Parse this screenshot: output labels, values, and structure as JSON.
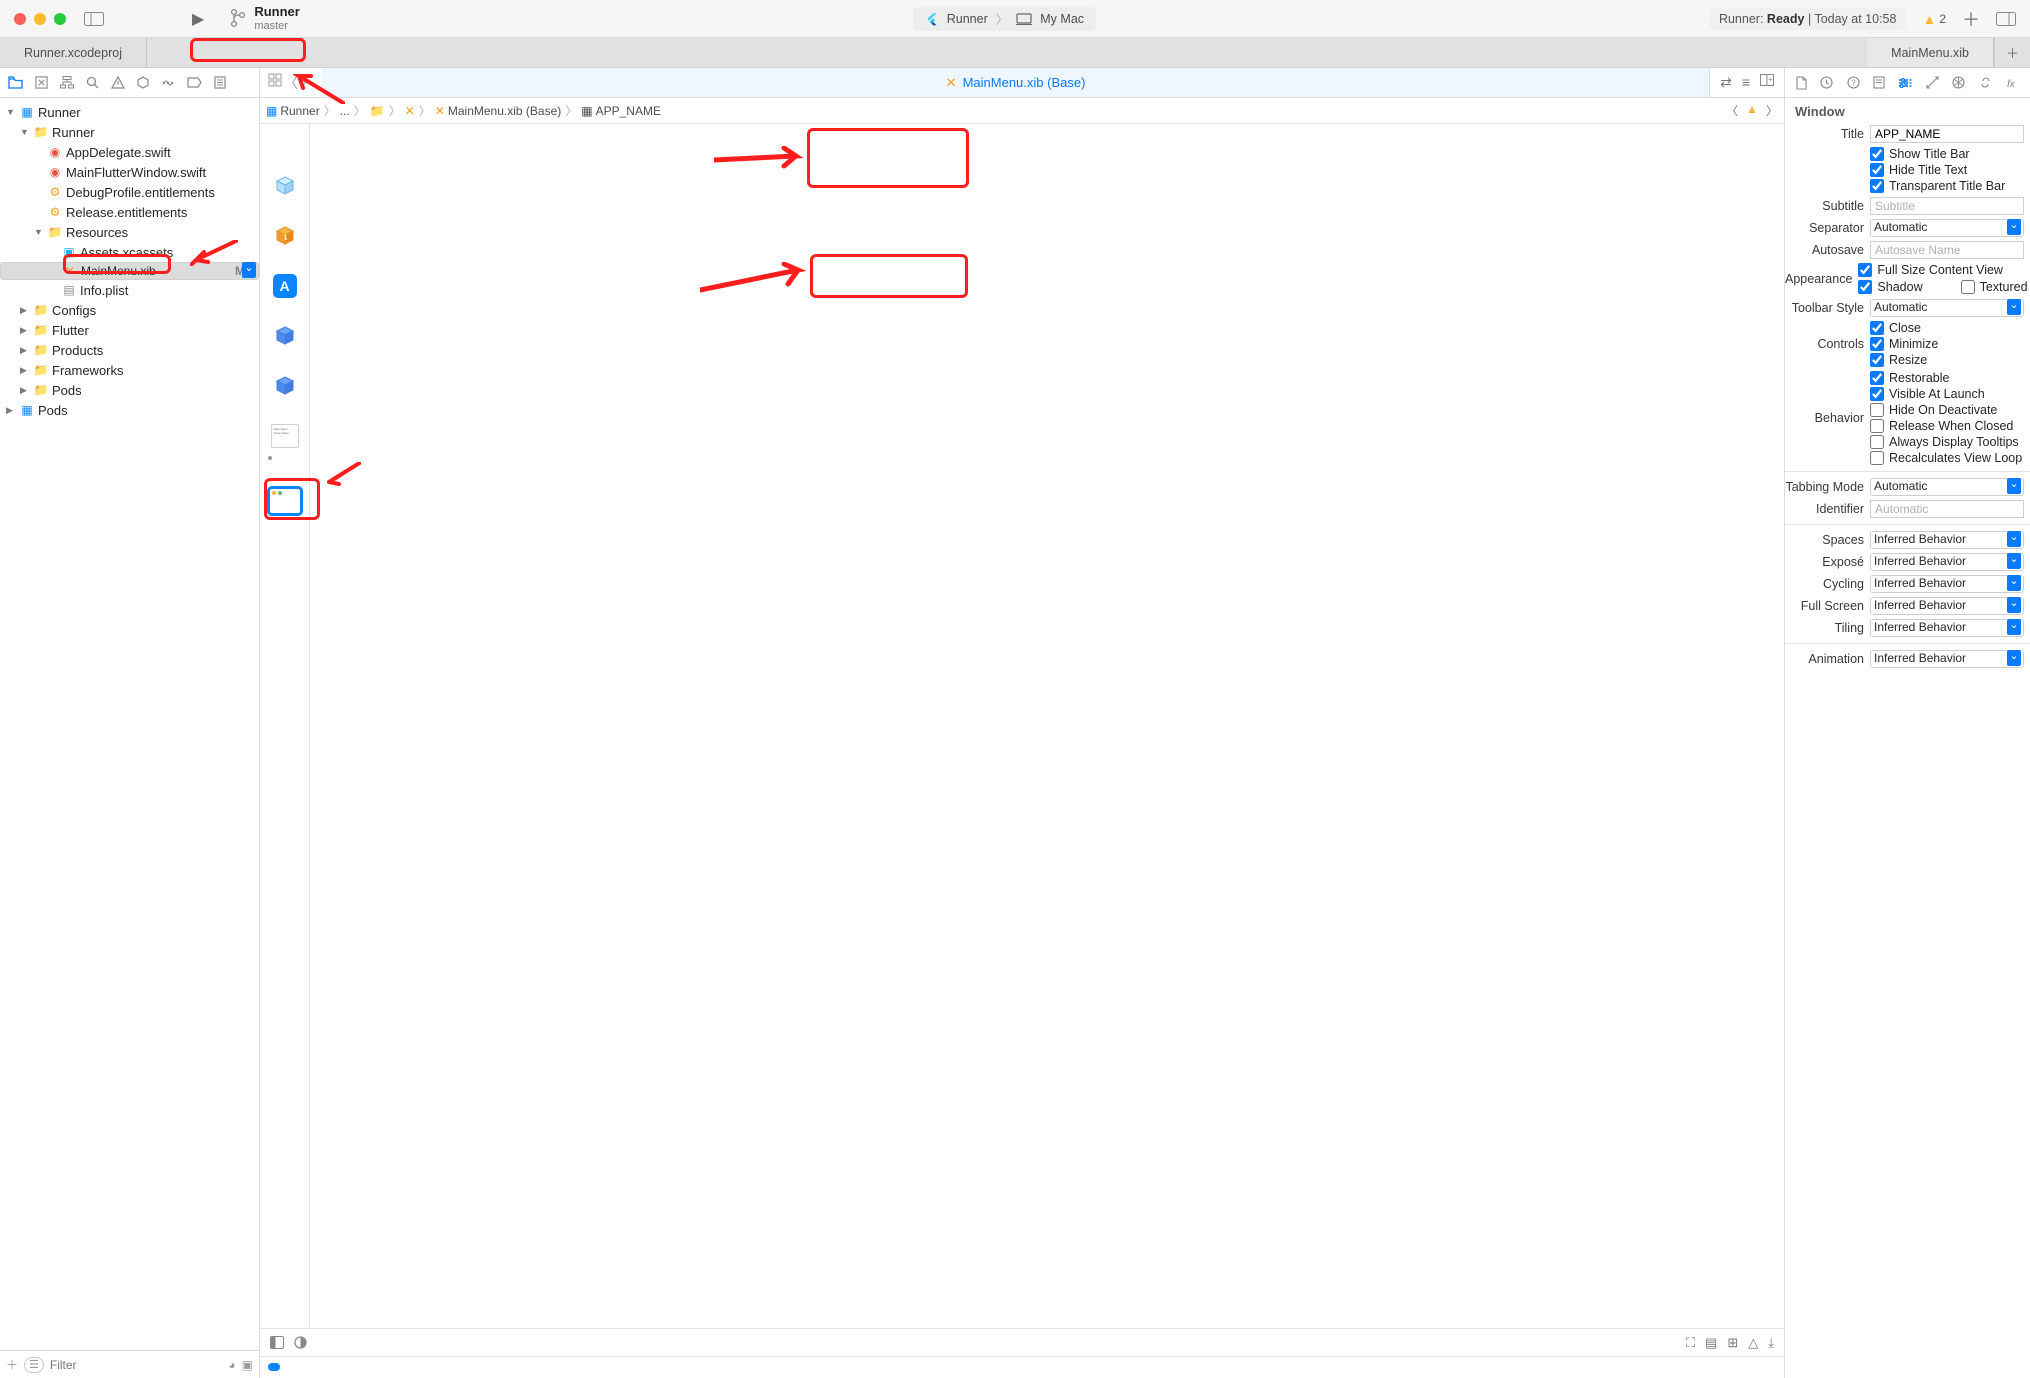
{
  "titlebar": {
    "project": "Runner",
    "branch": "master",
    "scheme_left": "Runner",
    "scheme_right": "My Mac",
    "status_prefix": "Runner:",
    "status_state": "Ready",
    "status_time": "Today at 10:58",
    "warn_count": "2"
  },
  "proj_tabs": {
    "left": "Runner.xcodeproj",
    "right": "MainMenu.xib"
  },
  "nav_tree": [
    {
      "d": 1,
      "icon": "proj",
      "label": "Runner",
      "disc": "▼"
    },
    {
      "d": 2,
      "icon": "fold",
      "label": "Runner",
      "disc": "▼"
    },
    {
      "d": 3,
      "icon": "swift",
      "label": "AppDelegate.swift"
    },
    {
      "d": 3,
      "icon": "swift",
      "label": "MainFlutterWindow.swift"
    },
    {
      "d": 3,
      "icon": "ent",
      "label": "DebugProfile.entitlements"
    },
    {
      "d": 3,
      "icon": "ent",
      "label": "Release.entitlements"
    },
    {
      "d": 3,
      "icon": "fold",
      "label": "Resources",
      "disc": "▼"
    },
    {
      "d": 4,
      "icon": "assets",
      "label": "Assets.xcassets"
    },
    {
      "d": 4,
      "icon": "xib",
      "label": "MainMenu.xib",
      "sel": true,
      "mod": "M"
    },
    {
      "d": 4,
      "icon": "plist",
      "label": "Info.plist"
    },
    {
      "d": 2,
      "icon": "fold",
      "label": "Configs",
      "disc": "▶"
    },
    {
      "d": 2,
      "icon": "fold",
      "label": "Flutter",
      "disc": "▶"
    },
    {
      "d": 2,
      "icon": "fold",
      "label": "Products",
      "disc": "▶"
    },
    {
      "d": 2,
      "icon": "fold",
      "label": "Frameworks",
      "disc": "▶"
    },
    {
      "d": 2,
      "icon": "fold",
      "label": "Pods",
      "disc": "▶"
    },
    {
      "d": 1,
      "icon": "proj",
      "label": "Pods",
      "disc": "▶"
    }
  ],
  "filter_placeholder": "Filter",
  "editor": {
    "tab_label": "MainMenu.xib (Base)",
    "crumbs": [
      "Runner",
      "",
      "",
      "",
      "MainMenu.xib (Base)",
      "APP_NAME"
    ],
    "menu_thumb": "New\nOpen…\n\nClose\nSave"
  },
  "insp": {
    "header": "Window",
    "title_label": "Title",
    "title_value": "APP_NAME",
    "ck_showtitle": "Show Title Bar",
    "ck_hidetitletext": "Hide Title Text",
    "ck_transp": "Transparent Title Bar",
    "subtitle_label": "Subtitle",
    "subtitle_ph": "Subtitle",
    "sep_label": "Separator",
    "sep_val": "Automatic",
    "autosave_label": "Autosave",
    "autosave_ph": "Autosave Name",
    "app_label": "Appearance",
    "ck_fullsize": "Full Size Content View",
    "ck_shadow": "Shadow",
    "ck_textured": "Textured",
    "tbstyle_label": "Toolbar Style",
    "tbstyle_val": "Automatic",
    "controls_label": "Controls",
    "ck_close": "Close",
    "ck_min": "Minimize",
    "ck_resize": "Resize",
    "behavior_label": "Behavior",
    "ck_restorable": "Restorable",
    "ck_visible": "Visible At Launch",
    "ck_hideondeact": "Hide On Deactivate",
    "ck_release": "Release When Closed",
    "ck_tooltips": "Always Display Tooltips",
    "ck_recalc": "Recalculates View Loop",
    "tabbing_label": "Tabbing Mode",
    "tabbing_val": "Automatic",
    "ident_label": "Identifier",
    "ident_ph": "Automatic",
    "spaces_label": "Spaces",
    "spaces_val": "Inferred Behavior",
    "expose_label": "Exposé",
    "expose_val": "Inferred Behavior",
    "cycling_label": "Cycling",
    "cycling_val": "Inferred Behavior",
    "fullscreen_label": "Full Screen",
    "fullscreen_val": "Inferred Behavior",
    "tiling_label": "Tiling",
    "tiling_val": "Inferred Behavior",
    "anim_label": "Animation",
    "anim_val": "Inferred Behavior"
  }
}
